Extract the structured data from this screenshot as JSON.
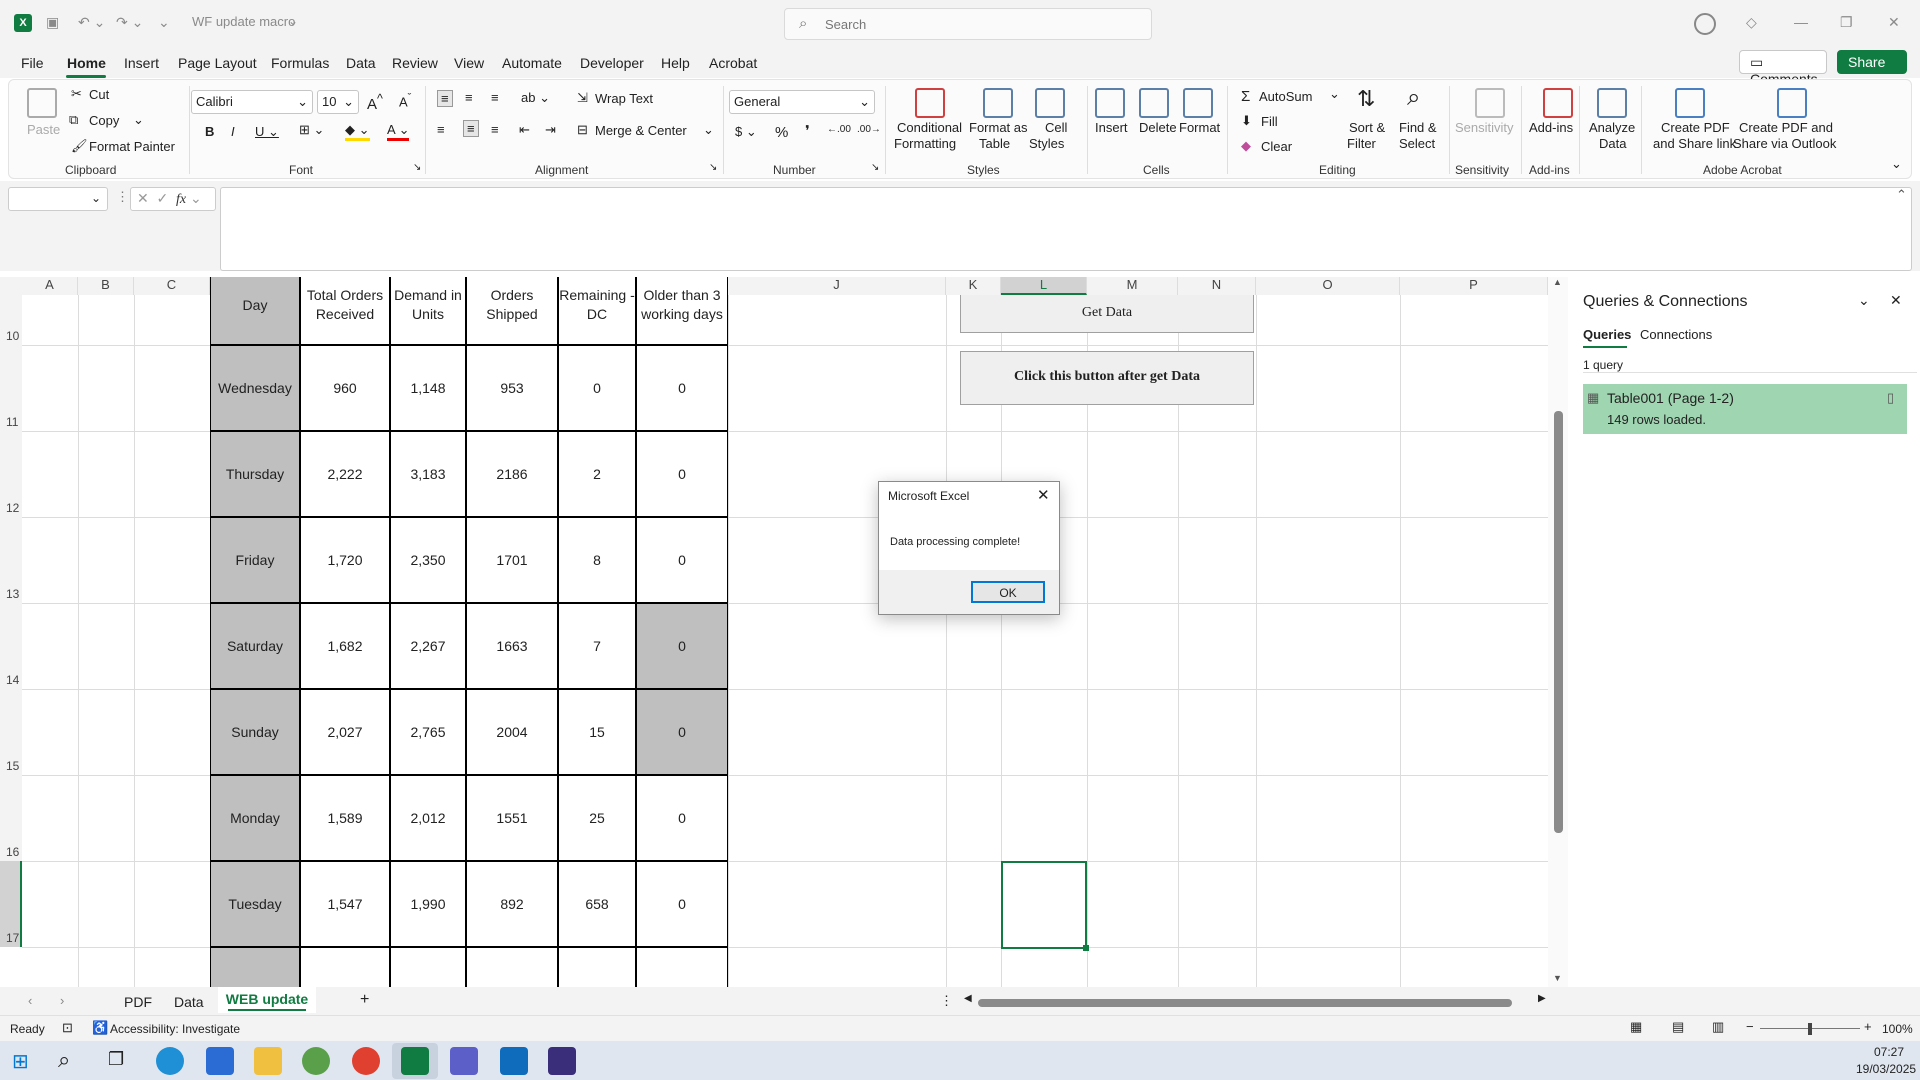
{
  "titlebar": {
    "filename": "WF update macro",
    "search_placeholder": "Search"
  },
  "menu": {
    "items": [
      "File",
      "Home",
      "Insert",
      "Page Layout",
      "Formulas",
      "Data",
      "Review",
      "View",
      "Automate",
      "Developer",
      "Help",
      "Acrobat"
    ],
    "active": "Home",
    "comments": "Comments",
    "share": "Share"
  },
  "ribbon": {
    "clipboard": {
      "paste": "Paste",
      "cut": "Cut",
      "copy": "Copy",
      "format_painter": "Format Painter",
      "label": "Clipboard"
    },
    "font": {
      "name": "Calibri",
      "size": "10",
      "label": "Font"
    },
    "alignment": {
      "wrap": "Wrap Text",
      "merge": "Merge & Center",
      "label": "Alignment"
    },
    "number": {
      "format": "General",
      "label": "Number"
    },
    "styles": {
      "cond_a": "Conditional",
      "cond_b": "Formatting",
      "fmt_a": "Format as",
      "fmt_b": "Table",
      "cell_a": "Cell",
      "cell_b": "Styles",
      "label": "Styles"
    },
    "cells": {
      "insert": "Insert",
      "delete": "Delete",
      "format": "Format",
      "label": "Cells"
    },
    "editing": {
      "autosum": "AutoSum",
      "fill": "Fill",
      "clear": "Clear",
      "sort_a": "Sort &",
      "sort_b": "Filter",
      "find_a": "Find &",
      "find_b": "Select",
      "label": "Editing"
    },
    "sensitivity": {
      "btn": "Sensitivity",
      "label": "Sensitivity"
    },
    "addins": {
      "btn": "Add-ins",
      "label": "Add-ins"
    },
    "analyze": {
      "a": "Analyze",
      "b": "Data"
    },
    "acrobat": {
      "pdf_a": "Create PDF",
      "pdf_b": "and Share link",
      "out_a": "Create PDF and",
      "out_b": "Share via Outlook",
      "label": "Adobe Acrobat"
    }
  },
  "formula": {
    "fx": "fx"
  },
  "columns": [
    "A",
    "B",
    "C",
    "D",
    "E",
    "F",
    "G",
    "H",
    "I",
    "J",
    "K",
    "L",
    "M",
    "N",
    "O",
    "P"
  ],
  "rows": [
    "10",
    "11",
    "12",
    "13",
    "14",
    "15",
    "16",
    "17"
  ],
  "table": {
    "headers": [
      "Day",
      "Total Orders Received",
      "Demand in Units",
      "Orders Shipped",
      "Remaining - DC",
      "Older than 3 working days"
    ],
    "data": [
      [
        "Wednesday",
        "960",
        "1,148",
        "953",
        "0",
        "0"
      ],
      [
        "Thursday",
        "2,222",
        "3,183",
        "2186",
        "2",
        "0"
      ],
      [
        "Friday",
        "1,720",
        "2,350",
        "1701",
        "8",
        "0"
      ],
      [
        "Saturday",
        "1,682",
        "2,267",
        "1663",
        "7",
        "0"
      ],
      [
        "Sunday",
        "2,027",
        "2,765",
        "2004",
        "15",
        "0"
      ],
      [
        "Monday",
        "1,589",
        "2,012",
        "1551",
        "25",
        "0"
      ],
      [
        "Tuesday",
        "1,547",
        "1,990",
        "892",
        "658",
        "0"
      ]
    ]
  },
  "buttons": {
    "get_data": "Get Data",
    "after": "Click this button after get Data"
  },
  "dialog": {
    "title": "Microsoft Excel",
    "message": "Data processing complete!",
    "ok": "OK"
  },
  "queries": {
    "title": "Queries & Connections",
    "tab_queries": "Queries",
    "tab_connections": "Connections",
    "count": "1 query",
    "item_name": "Table001 (Page 1-2)",
    "item_status": "149 rows loaded."
  },
  "sheets": {
    "tabs": [
      "PDF",
      "Data",
      "WEB update"
    ],
    "active": "WEB update"
  },
  "status": {
    "ready": "Ready",
    "accessibility": "Accessibility: Investigate",
    "zoom": "100%"
  },
  "taskbar": {
    "time": "07:27",
    "date": "19/03/2025"
  },
  "colors": {
    "excel_green": "#107c41",
    "query_bg": "#9fd5b0",
    "header_grey": "#bfbfbf"
  }
}
